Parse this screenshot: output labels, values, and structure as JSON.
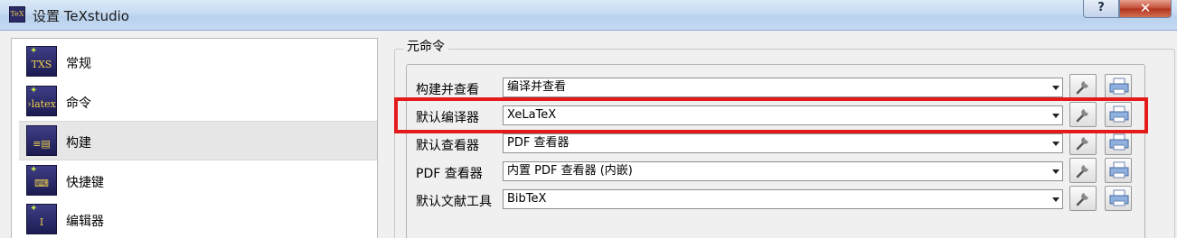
{
  "window": {
    "title": "设置 TeXstudio",
    "icon_text": "TeX",
    "help_label": "?",
    "close_label": "✕"
  },
  "sidebar": {
    "items": [
      {
        "label": "常规",
        "icon": "txs-general-icon",
        "icon_text": "TXS"
      },
      {
        "label": "命令",
        "icon": "latex-command-icon",
        "icon_text": "›latex"
      },
      {
        "label": "构建",
        "icon": "build-icon",
        "icon_text": "≡▤"
      },
      {
        "label": "快捷键",
        "icon": "keyboard-icon",
        "icon_text": "⌨"
      },
      {
        "label": "编辑器",
        "icon": "editor-cursor-icon",
        "icon_text": "I"
      }
    ],
    "selected_index": 2
  },
  "group": {
    "title": "元命令",
    "rows": [
      {
        "label": "构建并查看",
        "value": "编译并查看"
      },
      {
        "label": "默认编译器",
        "value": "XeLaTeX"
      },
      {
        "label": "默认查看器",
        "value": "PDF 查看器"
      },
      {
        "label": "PDF 查看器",
        "value": "内置 PDF 查看器 (内嵌)"
      },
      {
        "label": "默认文献工具",
        "value": "BibTeX"
      }
    ]
  },
  "colors": {
    "highlight": "#e41b1b",
    "titlebar": "#c7dbf2",
    "selected_item": "#e6e6e6"
  }
}
